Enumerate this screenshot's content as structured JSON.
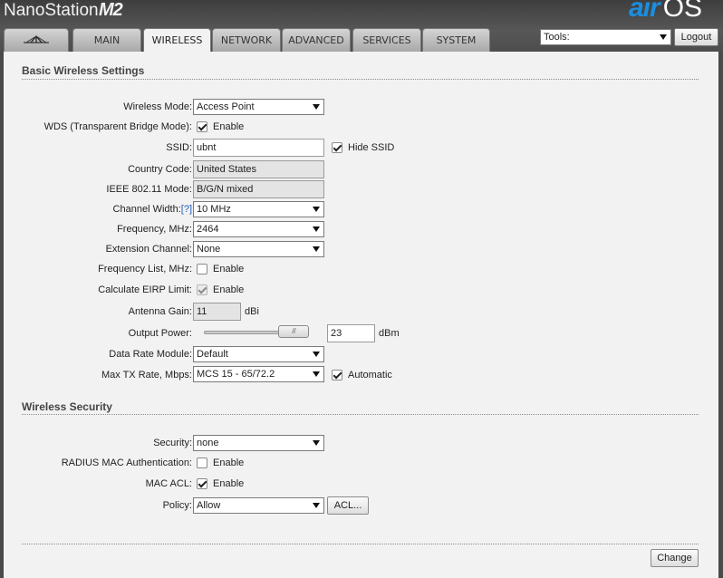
{
  "header": {
    "product": "NanoStation",
    "model": "M2",
    "logo_air": "air",
    "logo_os": "OS"
  },
  "tabs": [
    {
      "label": "",
      "icon": "ubiquiti-logo-icon",
      "active": false
    },
    {
      "label": "MAIN",
      "active": false
    },
    {
      "label": "WIRELESS",
      "active": true
    },
    {
      "label": "NETWORK",
      "active": false
    },
    {
      "label": "ADVANCED",
      "active": false
    },
    {
      "label": "SERVICES",
      "active": false
    },
    {
      "label": "SYSTEM",
      "active": false
    }
  ],
  "toolbar": {
    "tools_value": "Tools:",
    "logout_label": "Logout"
  },
  "basic": {
    "title": "Basic Wireless Settings",
    "wireless_mode": {
      "label": "Wireless Mode:",
      "value": "Access Point"
    },
    "wds": {
      "label": "WDS (Transparent Bridge Mode):",
      "checkbox_label": "Enable",
      "checked": true
    },
    "ssid": {
      "label": "SSID:",
      "value": "ubnt",
      "hide_label": "Hide SSID",
      "hide_checked": true
    },
    "country": {
      "label": "Country Code:",
      "value": "United States"
    },
    "ieee": {
      "label": "IEEE 802.11 Mode:",
      "value": "B/G/N mixed"
    },
    "channel_width": {
      "label": "Channel Width:",
      "help": "[?]",
      "value": "10 MHz"
    },
    "frequency": {
      "label": "Frequency, MHz:",
      "value": "2464"
    },
    "extension": {
      "label": "Extension Channel:",
      "value": "None"
    },
    "freq_list": {
      "label": "Frequency List, MHz:",
      "checkbox_label": "Enable",
      "checked": false
    },
    "eirp": {
      "label": "Calculate EIRP Limit:",
      "checkbox_label": "Enable",
      "checked": true
    },
    "antenna": {
      "label": "Antenna Gain:",
      "value": "11",
      "unit": "dBi"
    },
    "output_power": {
      "label": "Output Power:",
      "value": "23",
      "unit": "dBm"
    },
    "data_rate_module": {
      "label": "Data Rate Module:",
      "value": "Default"
    },
    "max_tx": {
      "label": "Max TX Rate, Mbps:",
      "value": "MCS 15 - 65/72.2",
      "auto_label": "Automatic",
      "auto_checked": true
    }
  },
  "security": {
    "title": "Wireless Security",
    "security": {
      "label": "Security:",
      "value": "none"
    },
    "radius": {
      "label": "RADIUS MAC Authentication:",
      "checkbox_label": "Enable",
      "checked": false
    },
    "mac_acl": {
      "label": "MAC ACL:",
      "checkbox_label": "Enable",
      "checked": true
    },
    "policy": {
      "label": "Policy:",
      "value": "Allow",
      "acl_label": "ACL..."
    }
  },
  "footer": {
    "change_label": "Change"
  }
}
